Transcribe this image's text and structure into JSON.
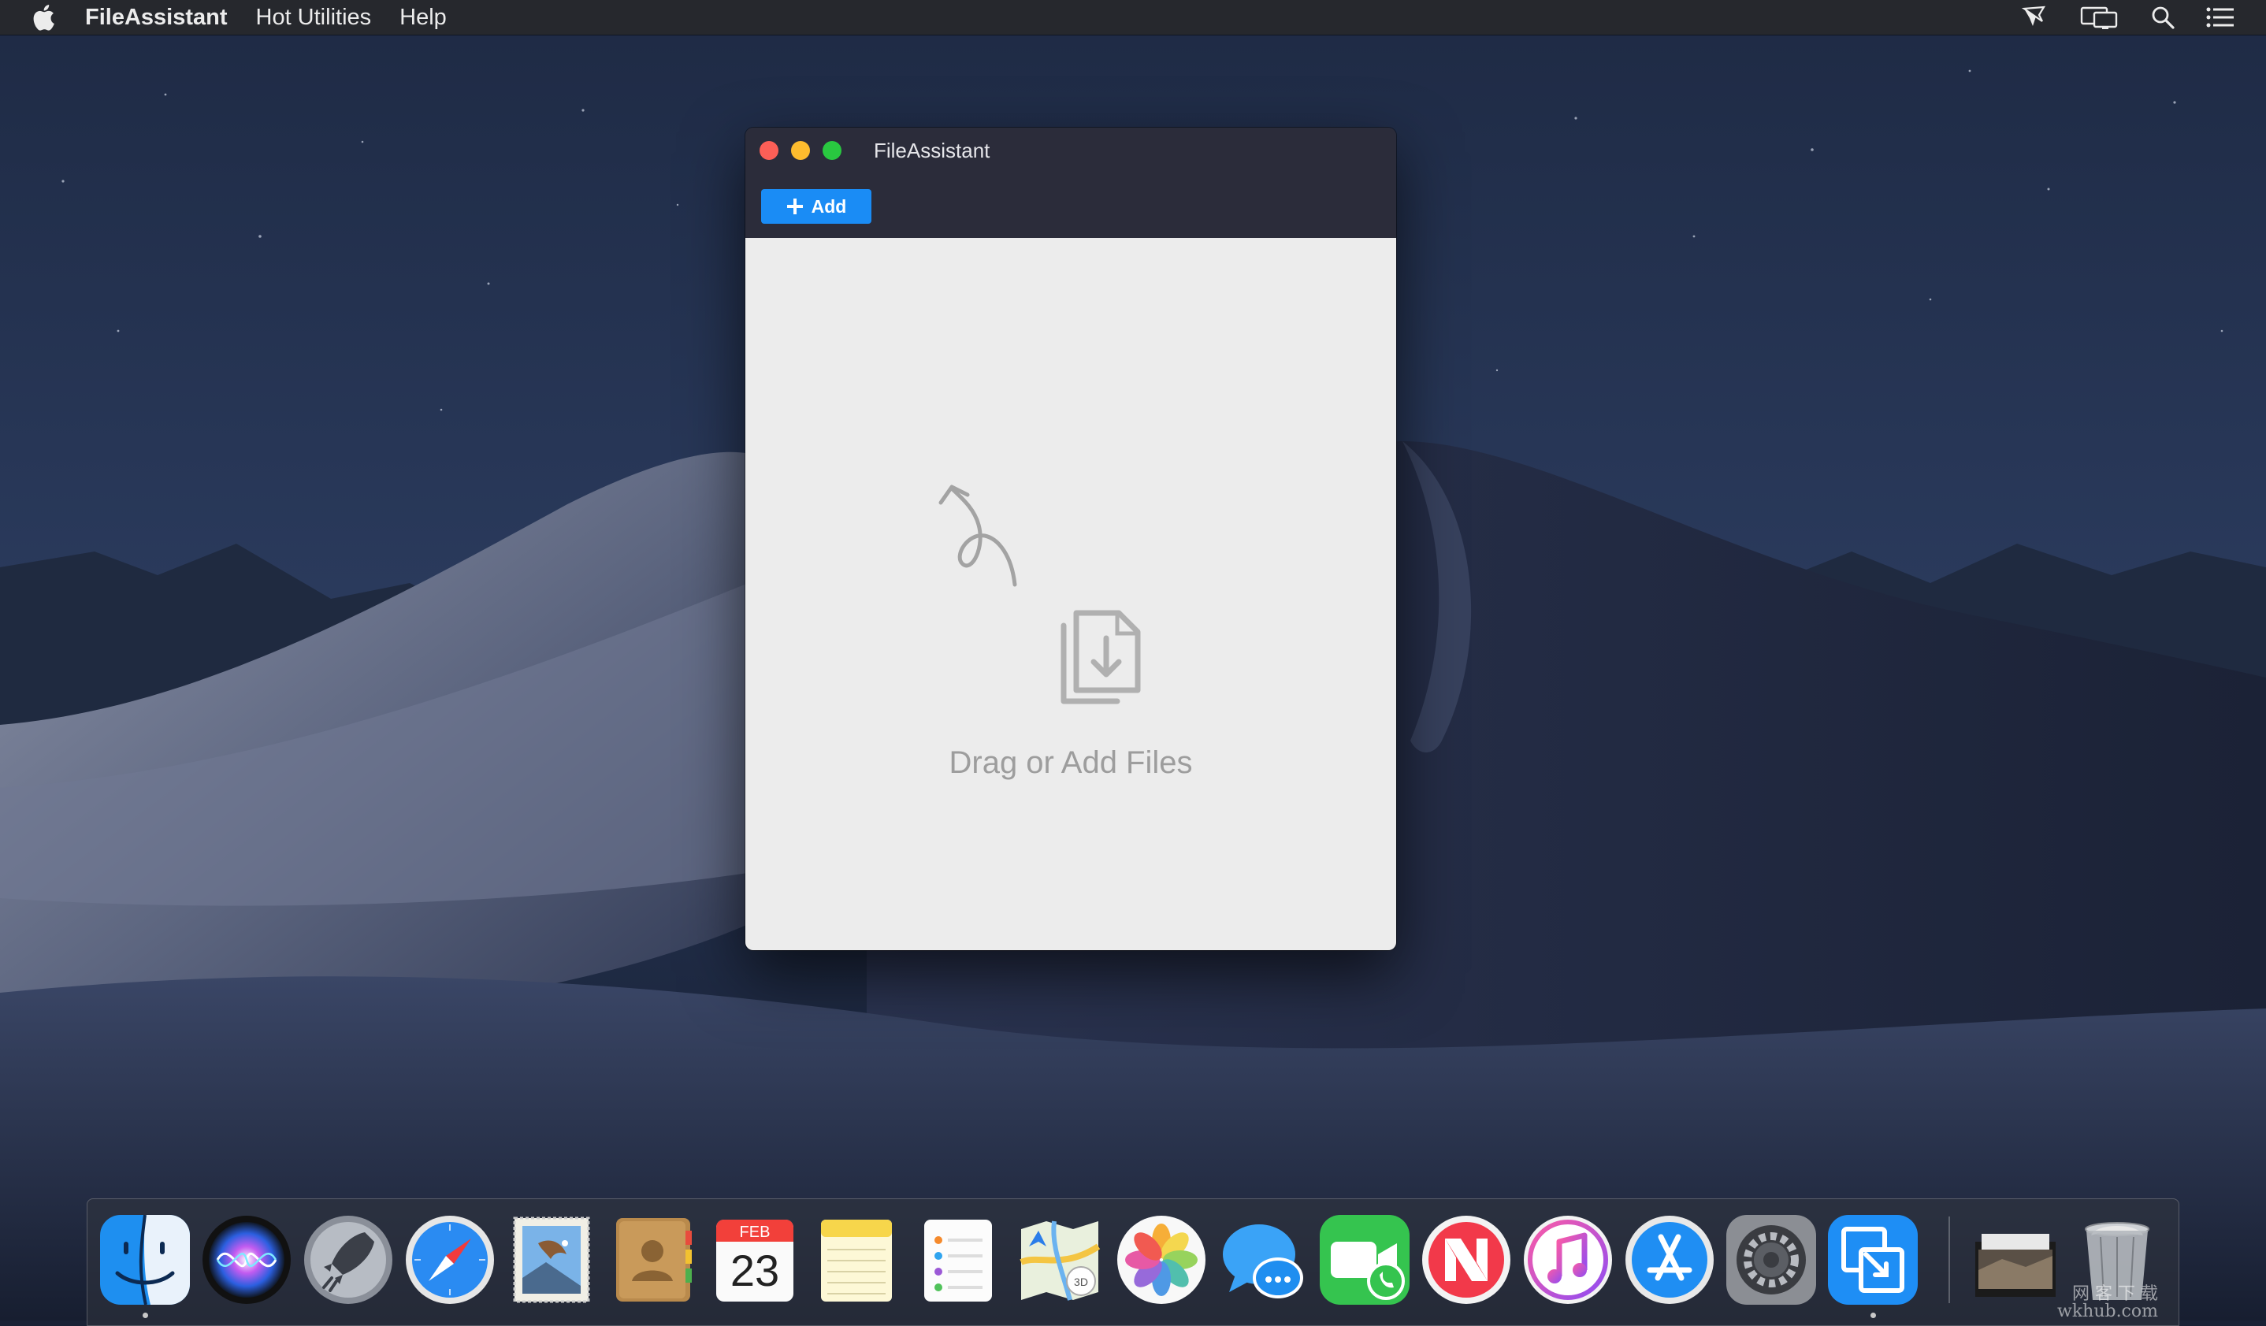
{
  "menubar": {
    "apple_icon": "apple-icon",
    "app_name": "FileAssistant",
    "menus": [
      "Hot Utilities",
      "Help"
    ],
    "status_icons": [
      "airplay-cast-icon",
      "screen-mirroring-icon",
      "spotlight-search-icon",
      "notification-center-icon"
    ]
  },
  "window": {
    "title": "FileAssistant",
    "add_label": "Add",
    "drop_hint": "Drag or Add Files",
    "icons": [
      "curved-arrow-icon",
      "file-download-icon",
      "plus-icon"
    ],
    "colors": {
      "titlebar": "#2b2c3a",
      "add_button": "#1a8cf5",
      "content": "#ececec",
      "hint": "#9d9d9d"
    }
  },
  "dock": {
    "apps": [
      {
        "name": "finder-icon",
        "running": true
      },
      {
        "name": "siri-icon",
        "running": false
      },
      {
        "name": "launchpad-icon",
        "running": false
      },
      {
        "name": "safari-icon",
        "running": false
      },
      {
        "name": "mail-icon",
        "running": false
      },
      {
        "name": "contacts-icon",
        "running": false
      },
      {
        "name": "calendar-icon",
        "running": false,
        "month": "FEB",
        "day": "23"
      },
      {
        "name": "notes-icon",
        "running": false
      },
      {
        "name": "reminders-icon",
        "running": false
      },
      {
        "name": "maps-icon",
        "running": false
      },
      {
        "name": "photos-icon",
        "running": false
      },
      {
        "name": "messages-icon",
        "running": false
      },
      {
        "name": "facetime-icon",
        "running": false
      },
      {
        "name": "news-icon",
        "running": false
      },
      {
        "name": "itunes-icon",
        "running": false
      },
      {
        "name": "app-store-icon",
        "running": false
      },
      {
        "name": "system-preferences-icon",
        "running": false
      },
      {
        "name": "fileassistant-icon",
        "running": true
      }
    ],
    "extras": [
      "downloads-stack-icon",
      "trash-icon"
    ]
  },
  "watermark": {
    "line1": "网 客 下 载",
    "line2": "wkhub.com"
  }
}
